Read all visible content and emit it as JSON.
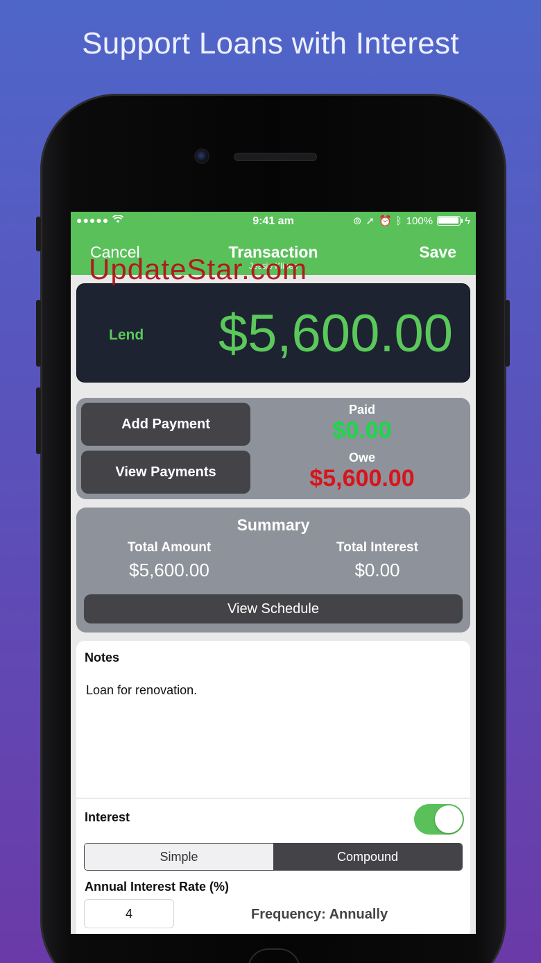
{
  "headline": "Support Loans with Interest",
  "status_bar": {
    "signal": "●●●●●",
    "time": "9:41 am",
    "battery": "100%",
    "battery_level": 1.0
  },
  "nav": {
    "cancel_label": "Cancel",
    "title": "Transaction",
    "subtitle": "Jessie Klines",
    "save_label": "Save"
  },
  "amount": {
    "type_label": "Lend",
    "value": "$5,600.00"
  },
  "payments": {
    "add_button": "Add Payment",
    "view_button": "View Payments",
    "paid_label": "Paid",
    "paid_value": "$0.00",
    "owe_label": "Owe",
    "owe_value": "$5,600.00"
  },
  "watermark": "UpdateStar.com",
  "summary": {
    "title": "Summary",
    "total_amount_label": "Total Amount",
    "total_amount_value": "$5,600.00",
    "total_interest_label": "Total Interest",
    "total_interest_value": "$0.00",
    "schedule_button": "View Schedule"
  },
  "notes": {
    "label": "Notes",
    "text": "Loan for renovation."
  },
  "interest": {
    "label": "Interest",
    "enabled": true,
    "options": [
      "Simple",
      "Compound"
    ],
    "selected": "Compound",
    "rate_label": "Annual Interest Rate (%)",
    "rate_value": "4",
    "frequency": "Frequency: Annually"
  },
  "colors": {
    "accent_green": "#5ac05a",
    "paid_green": "#19d94a",
    "owe_red": "#d8141a",
    "card_gray": "#8e929a",
    "button_dark": "#444448",
    "amount_card_bg": "#1d2331"
  }
}
